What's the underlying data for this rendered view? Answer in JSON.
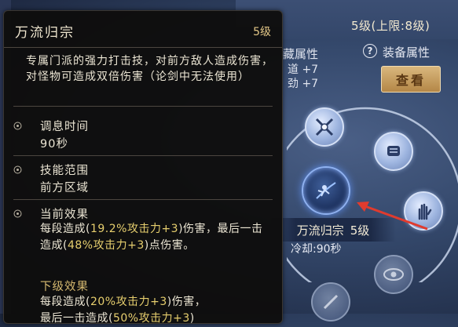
{
  "background": {
    "level_text": "5级(上限:8级)",
    "hidden_attr_title": "藏属性",
    "attr_lines": [
      "道 +7",
      "劲 +7"
    ],
    "equip_attr_label": "装备属性",
    "help_glyph": "?",
    "view_button": "查看",
    "selected_skill_name": "万流归宗",
    "selected_skill_level": "5级",
    "cooldown": "冷却:90秒"
  },
  "tooltip": {
    "title": "万流归宗",
    "level": "5级",
    "description": "专属门派的强力打击技，对前方敌人造成伤害，对怪物可造成双倍伤害（论剑中无法使用）",
    "sections": [
      {
        "label": "调息时间",
        "value": "90秒"
      },
      {
        "label": "技能范围",
        "value": "前方区域"
      }
    ],
    "current_effect": {
      "label": "当前效果",
      "parts": [
        "每段造成(",
        "19.2%攻击力+3",
        ")伤害，最后一击造成(",
        "48%攻击力+3",
        ")点伤害。"
      ]
    },
    "next_effect": {
      "label": "下级效果",
      "parts": [
        "每段造成(",
        "20%攻击力+3",
        ")伤害，",
        "最后一击造成(",
        "50%攻击力+3",
        ")"
      ]
    }
  },
  "colors": {
    "highlight": "#e7cf6e",
    "arrow": "#e03b2e",
    "button": "#c9a062"
  }
}
